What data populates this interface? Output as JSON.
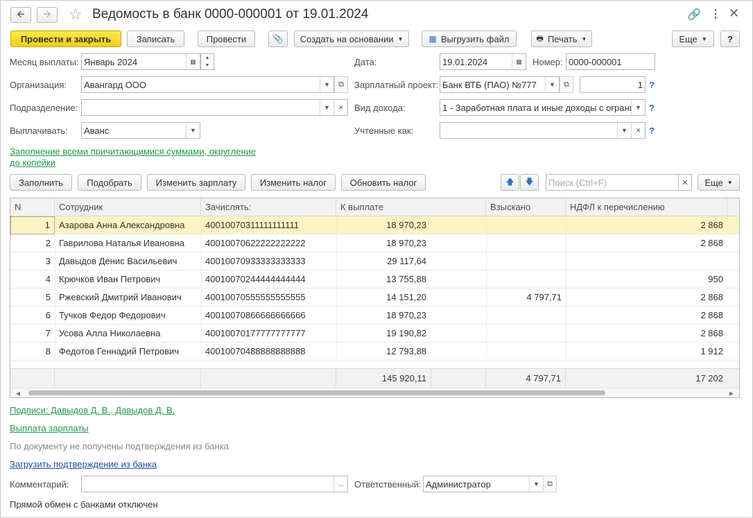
{
  "header": {
    "title": "Ведомость в банк 0000-000001 от 19.01.2024",
    "back_icon": "arrow-left",
    "forward_icon": "arrow-right",
    "star_icon": "star",
    "link_icon": "link",
    "menu_icon": "kebab",
    "close_icon": "close"
  },
  "toolbar": {
    "post_close": "Провести и закрыть",
    "save": "Записать",
    "post": "Провести",
    "create_based": "Создать на основании",
    "upload_file": "Выгрузить файл",
    "print": "Печать",
    "more": "Еще",
    "help": "?"
  },
  "form": {
    "month_label": "Месяц выплаты:",
    "month_value": "Январь 2024",
    "date_label": "Дата:",
    "date_value": "19.01.2024",
    "number_label": "Номер:",
    "number_value": "0000-000001",
    "org_label": "Организация:",
    "org_value": "Авангард ООО",
    "project_label": "Зарплатный проект:",
    "project_value": "Банк ВТБ (ПАО) №777",
    "project_count": "1",
    "division_label": "Подразделение:",
    "division_value": "",
    "income_label": "Вид дохода:",
    "income_value": "1 - Заработная плата и иные доходы с ограни",
    "pay_label": "Выплачивать:",
    "pay_value": "Аванс",
    "counted_label": "Учтенные как:",
    "counted_value": "",
    "q": "?",
    "fill_link_1": "Заполнение всеми причитающимися суммами, округление",
    "fill_link_2": "до копейки"
  },
  "table_toolbar": {
    "fill": "Заполнить",
    "pick": "Подобрать",
    "change_salary": "Изменить зарплату",
    "change_tax": "Изменить налог",
    "refresh_tax": "Обновить налог",
    "search_placeholder": "Поиск (Ctrl+F)",
    "more": "Еще"
  },
  "table": {
    "columns": [
      "N",
      "Сотрудник",
      "Зачислять:",
      "К выплате",
      "Взыскано",
      "НДФЛ к перечислению"
    ],
    "rows": [
      {
        "n": "1",
        "name": "Азарова Анна Александровна",
        "account": "40010070311111111111",
        "pay": "18 970,23",
        "withheld": "",
        "ndfl": "2 868"
      },
      {
        "n": "2",
        "name": "Гаврилова Наталья Ивановна",
        "account": "40010070622222222222",
        "pay": "18 970,23",
        "withheld": "",
        "ndfl": "2 868"
      },
      {
        "n": "3",
        "name": "Давыдов Денис Васильевич",
        "account": "40010070933333333333",
        "pay": "29 117,64",
        "withheld": "",
        "ndfl": ""
      },
      {
        "n": "4",
        "name": "Крючков Иван Петрович",
        "account": "40010070244444444444",
        "pay": "13 755,88",
        "withheld": "",
        "ndfl": "950"
      },
      {
        "n": "5",
        "name": "Ржевский Дмитрий Иванович",
        "account": "40010070555555555555",
        "pay": "14 151,20",
        "withheld": "4 797,71",
        "ndfl": "2 868"
      },
      {
        "n": "6",
        "name": "Тучков Федор Федорович",
        "account": "40010070866666666666",
        "pay": "18 970,23",
        "withheld": "",
        "ndfl": "2 868"
      },
      {
        "n": "7",
        "name": "Усова Алла Николаевна",
        "account": "40010070177777777777",
        "pay": "19 190,82",
        "withheld": "",
        "ndfl": "2 868"
      },
      {
        "n": "8",
        "name": "Федотов Геннадий Петрович",
        "account": "40010070488888888888",
        "pay": "12 793,88",
        "withheld": "",
        "ndfl": "1 912"
      }
    ],
    "totals": {
      "pay": "145 920,11",
      "withheld": "4 797,71",
      "ndfl": "17 202"
    }
  },
  "bottom": {
    "signatures_link": "Подписи: Давыдов Д. В., Давыдов Д. В.",
    "salary_link": "Выплата зарплаты",
    "status_text": "По документу не получены подтверждения из банка",
    "load_link": "Загрузить подтверждение из банка",
    "comment_label": "Комментарий:",
    "comment_value": "",
    "responsible_label": "Ответственный:",
    "responsible_value": "Администратор",
    "exchange_text": "Прямой обмен с банками отключен"
  }
}
